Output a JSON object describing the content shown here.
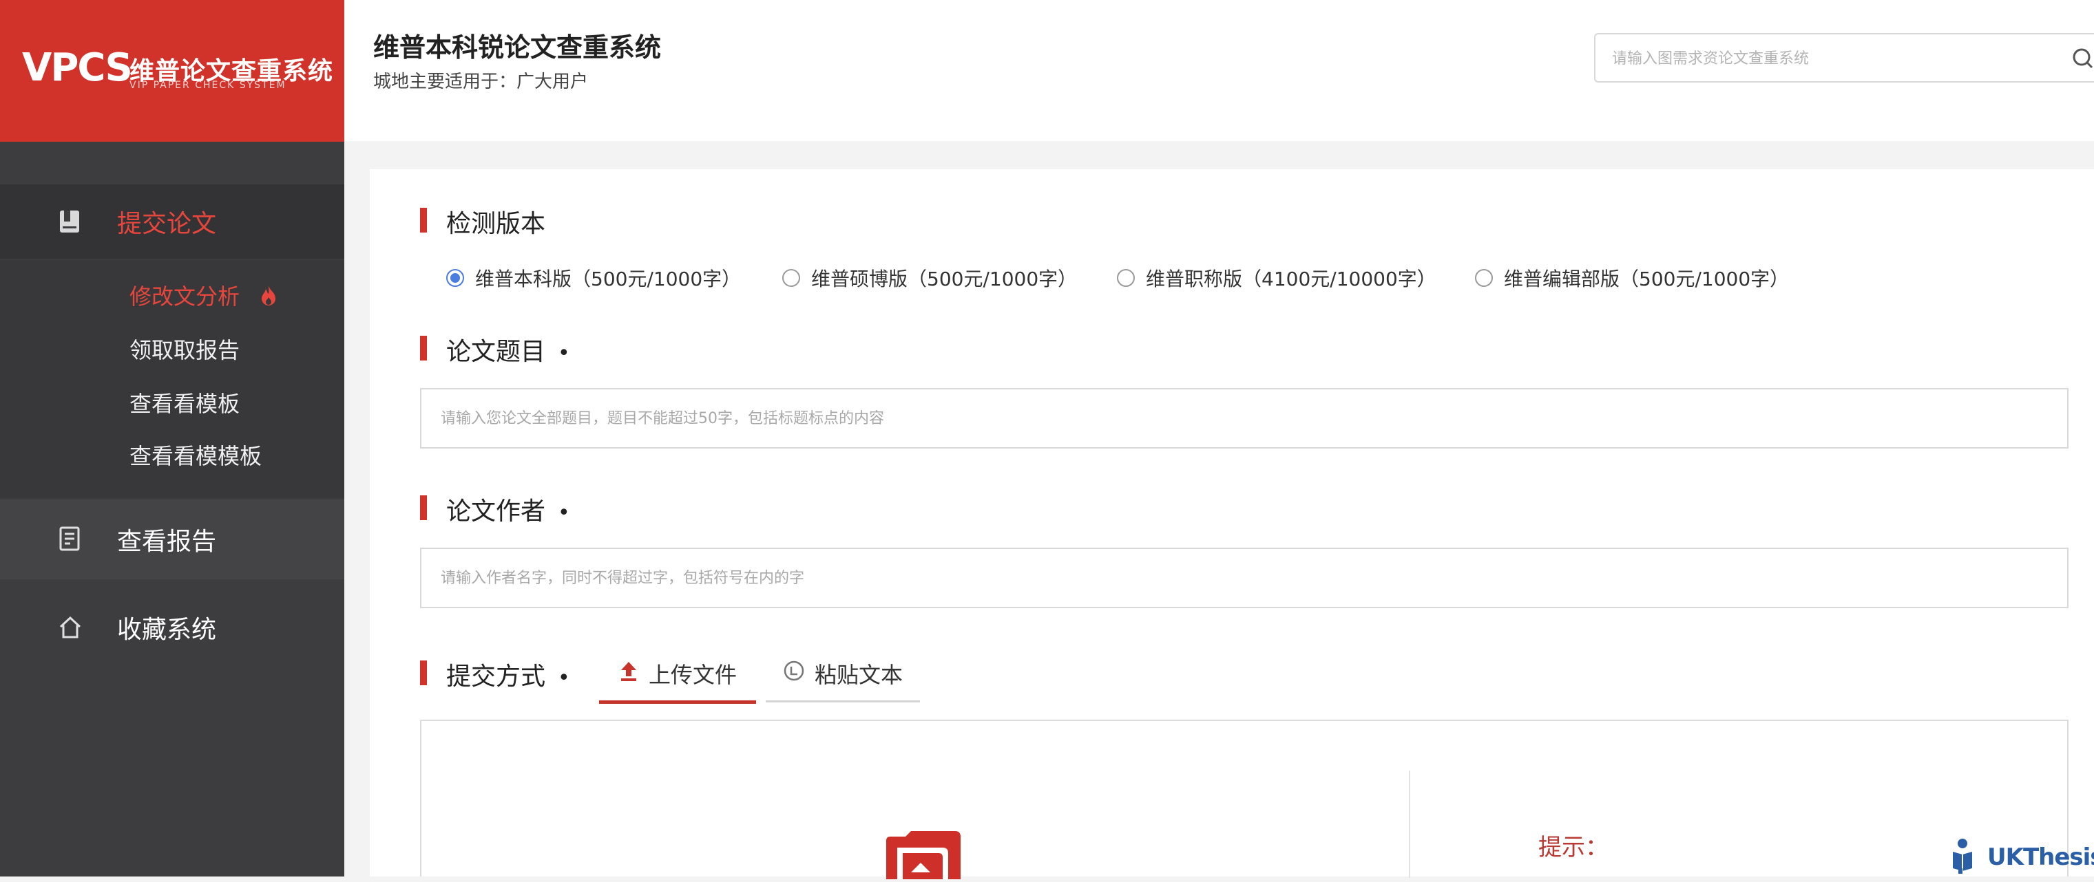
{
  "brand": {
    "logo_text": "VPCS",
    "name": "维普论文查重系统",
    "subtitle": "VIP PAPER CHECK SYSTEM",
    "color": "#d1332b"
  },
  "sidebar": {
    "items": [
      {
        "label": "提交论文",
        "icon": "book-icon",
        "active": true
      },
      {
        "label": "查看报告",
        "icon": "report-icon",
        "active": false
      },
      {
        "label": "收藏系统",
        "icon": "home-icon",
        "active": false
      }
    ],
    "subitems": [
      {
        "label": "修改文分析",
        "active": true,
        "icon": "flame-icon"
      },
      {
        "label": "领取取报告",
        "active": false
      },
      {
        "label": "查看看模板",
        "active": false
      },
      {
        "label": "查看看模模板",
        "active": false
      }
    ]
  },
  "header": {
    "title": "维普本科锐论文查重系统",
    "subtitle": "城地主要适用于：广大用户",
    "search_placeholder": "请输入图需求资论文查重系统"
  },
  "form": {
    "version_title": "检测版本",
    "versions": [
      {
        "label": "维普本科版（500元/1000字）",
        "checked": true
      },
      {
        "label": "维普硕博版（500元/1000字）",
        "checked": false
      },
      {
        "label": "维普职称版（4100元/10000字）",
        "checked": false
      },
      {
        "label": "维普编辑部版（500元/1000字）",
        "checked": false
      }
    ],
    "title_label": "论文题目",
    "title_placeholder": "请输入您论文全部题目，题目不能超过50字，包括标题标点的内容",
    "author_label": "论文作者",
    "author_placeholder": "请输入作者名字，同时不得超过字，包括符号在内的字",
    "submit_label": "提交方式",
    "required_mark": "•",
    "tabs": [
      {
        "label": "上传文件",
        "icon": "upload-icon",
        "active": true
      },
      {
        "label": "粘贴文本",
        "icon": "paste-icon",
        "active": false
      }
    ],
    "tip_label": "提示："
  },
  "watermark": {
    "text": "UKThesis"
  },
  "colors": {
    "accent": "#d1332b",
    "active_text": "#e8453c",
    "sidebar_bg": "#3d3d40",
    "radio_checked": "#4a7de0"
  }
}
